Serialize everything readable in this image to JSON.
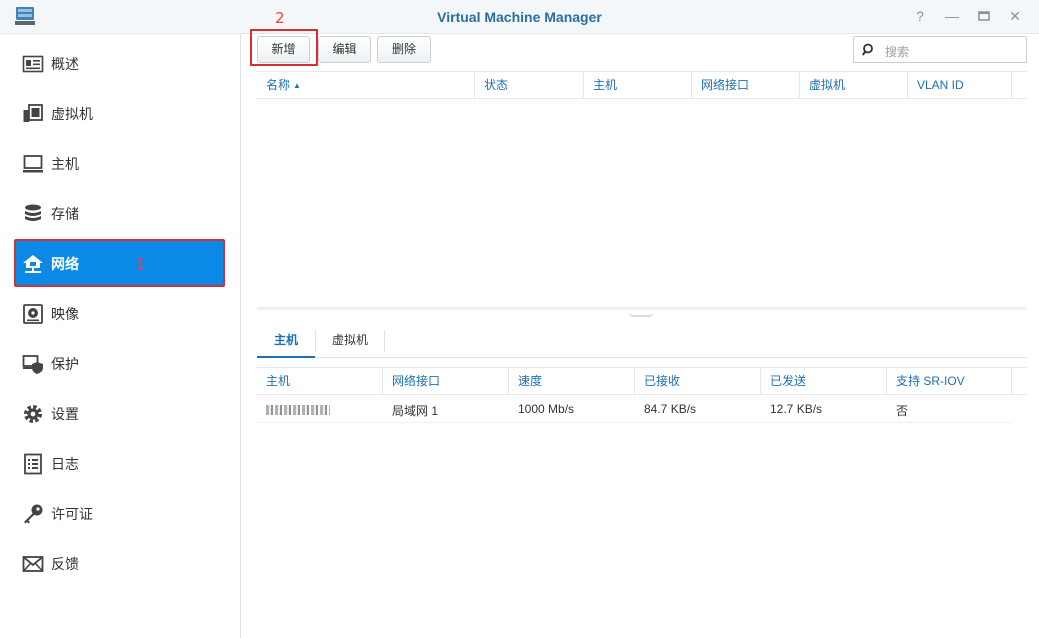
{
  "window": {
    "title": "Virtual Machine Manager",
    "controls": [
      "help-icon",
      "minimize-icon",
      "maximize-icon",
      "close-icon"
    ]
  },
  "sidebar": {
    "items": [
      {
        "label": "概述",
        "icon": "overview-icon"
      },
      {
        "label": "虚拟机",
        "icon": "virtual-machine-icon"
      },
      {
        "label": "主机",
        "icon": "host-icon"
      },
      {
        "label": "存储",
        "icon": "storage-icon"
      },
      {
        "label": "网络",
        "icon": "network-icon",
        "active": true
      },
      {
        "label": "映像",
        "icon": "image-icon"
      },
      {
        "label": "保护",
        "icon": "protection-icon"
      },
      {
        "label": "设置",
        "icon": "settings-gear-icon"
      },
      {
        "label": "日志",
        "icon": "log-icon"
      },
      {
        "label": "许可证",
        "icon": "license-key-icon"
      },
      {
        "label": "反馈",
        "icon": "feedback-mail-icon"
      }
    ],
    "annotation": "1"
  },
  "toolbar": {
    "add_label": "新增",
    "edit_label": "编辑",
    "delete_label": "删除",
    "annotation": "2",
    "search_placeholder": "搜索"
  },
  "network_table": {
    "columns": [
      "名称",
      "状态",
      "主机",
      "网络接口",
      "虚拟机",
      "VLAN ID"
    ],
    "rows": []
  },
  "detail_tabs": [
    "主机",
    "虚拟机"
  ],
  "detail_table": {
    "columns": [
      "主机",
      "网络接口",
      "速度",
      "已接收",
      "已发送",
      "支持 SR-IOV"
    ],
    "rows": [
      {
        "interface": "局域网 1",
        "speed": "1000 Mb/s",
        "received": "84.7 KB/s",
        "sent": "12.7 KB/s",
        "sriov": "否"
      }
    ]
  },
  "colors": {
    "accent": "#0a8ae6",
    "header_text": "#1f6fb0",
    "annotation": "#d23232"
  }
}
